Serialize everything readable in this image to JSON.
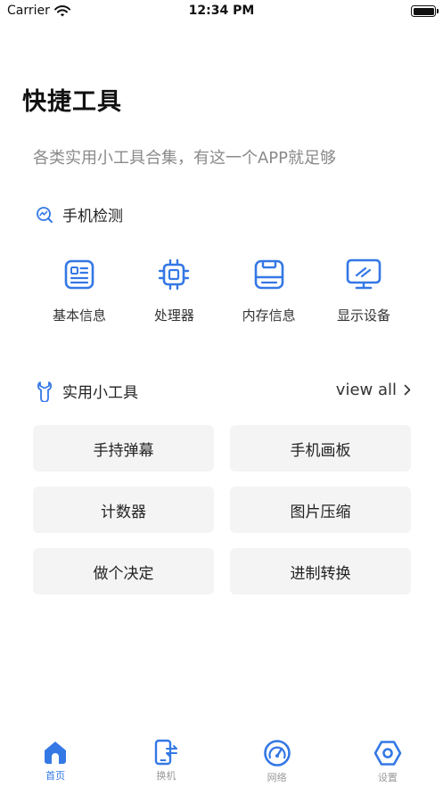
{
  "status_bar": {
    "carrier": "Carrier",
    "time": "12:34 PM",
    "battery_level": 1.0
  },
  "header": {
    "title": "快捷工具",
    "subtitle": "各类实用小工具合集，有这一个APP就足够"
  },
  "phone_check": {
    "title": "手机检测",
    "icon": "chart-search-icon",
    "items": [
      {
        "label": "基本信息",
        "icon": "info-card-icon"
      },
      {
        "label": "处理器",
        "icon": "cpu-chip-icon"
      },
      {
        "label": "内存信息",
        "icon": "storage-icon"
      },
      {
        "label": "显示设备",
        "icon": "monitor-icon"
      }
    ]
  },
  "utilities": {
    "title": "实用小工具",
    "icon": "wrench-icon",
    "view_all": "view all",
    "tools": [
      "手持弹幕",
      "手机画板",
      "计数器",
      "图片压缩",
      "做个决定",
      "进制转换"
    ]
  },
  "tab_bar": {
    "tabs": [
      {
        "label": "首页",
        "icon": "home-icon",
        "active": true
      },
      {
        "label": "换机",
        "icon": "phone-transfer-icon",
        "active": false
      },
      {
        "label": "网络",
        "icon": "speedometer-icon",
        "active": false
      },
      {
        "label": "设置",
        "icon": "settings-hexagon-icon",
        "active": false
      }
    ]
  },
  "colors": {
    "accent": "#3478e5",
    "tool_background": "#f4f4f4",
    "subtitle": "#8a8a8a"
  }
}
